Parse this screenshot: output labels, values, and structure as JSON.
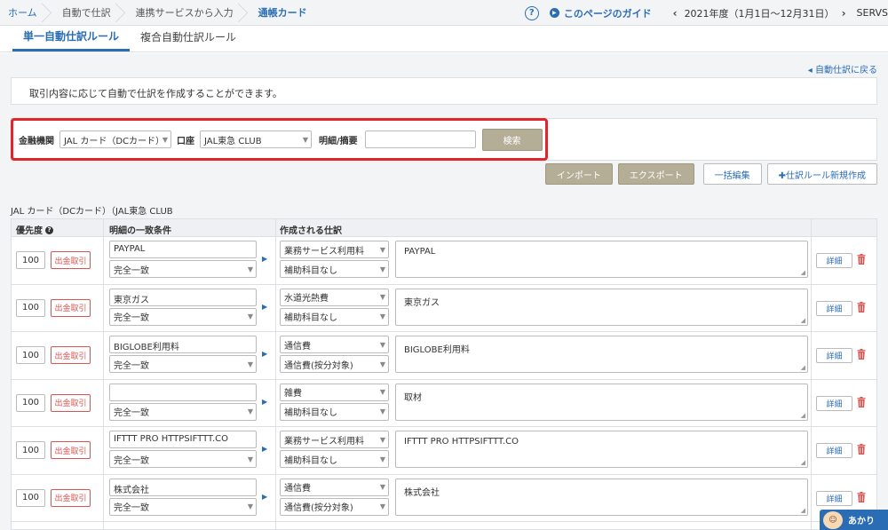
{
  "breadcrumb": [
    "ホーム",
    "自動で仕訳",
    "連携サービスから入力",
    "通帳カード"
  ],
  "header": {
    "help_icon": "?",
    "guide_label": "このページのガイド",
    "fiscal_year": "2021年度（1月1日〜12月31日）",
    "company": "SERVS"
  },
  "tabs": [
    {
      "label": "単一自動仕訳ルール",
      "active": true
    },
    {
      "label": "複合自動仕訳ルール",
      "active": false
    }
  ],
  "back_link": "自動仕訳に戻る",
  "description": "取引内容に応じて自動で仕訳を作成することができます。",
  "search": {
    "institution_label": "金融機関",
    "institution_value": "JAL カード（DCカード）",
    "account_label": "口座",
    "account_value": "JAL東急 CLUB",
    "detail_label": "明細/摘要",
    "detail_value": "",
    "search_button": "検索"
  },
  "actions": {
    "import": "インポート",
    "export": "エクスポート",
    "bulk_edit": "一括編集",
    "new_rule": "✚仕訳ルール新規作成"
  },
  "card_caption": "JAL カード（DCカード）（JAL東急 CLUB",
  "table": {
    "col_priority": "優先度",
    "col_condition": "明細の一致条件",
    "col_created": "作成される仕訳"
  },
  "rows": [
    {
      "priority": "100",
      "type": "出金取引",
      "condition": "PAYPAL",
      "match": "完全一致",
      "account": "業務サービス利用料",
      "sub_account": "補助科目なし",
      "memo": "PAYPAL",
      "detail": "詳細"
    },
    {
      "priority": "100",
      "type": "出金取引",
      "condition": "東京ガス",
      "match": "完全一致",
      "account": "水道光熱費",
      "sub_account": "補助科目なし",
      "memo": "東京ガス",
      "detail": "詳細"
    },
    {
      "priority": "100",
      "type": "出金取引",
      "condition": "BIGLOBE利用料",
      "match": "完全一致",
      "account": "通信費",
      "sub_account": "通信費(按分対象)",
      "memo": "BIGLOBE利用料",
      "detail": "詳細"
    },
    {
      "priority": "100",
      "type": "出金取引",
      "condition": "",
      "match": "完全一致",
      "account": "雑費",
      "sub_account": "補助科目なし",
      "memo": "取材",
      "detail": "詳細"
    },
    {
      "priority": "100",
      "type": "出金取引",
      "condition": "IFTTT PRO HTTPSIFTTT.CO",
      "match": "完全一致",
      "account": "業務サービス利用料",
      "sub_account": "補助科目なし",
      "memo": "IFTTT PRO HTTPSIFTTT.CO",
      "detail": "詳細"
    },
    {
      "priority": "100",
      "type": "出金取引",
      "condition": "株式会社",
      "match": "完全一致",
      "account": "通信費",
      "sub_account": "通信費(按分対象)",
      "memo": "株式会社",
      "detail": "詳細"
    }
  ],
  "chat_label": "あかり"
}
